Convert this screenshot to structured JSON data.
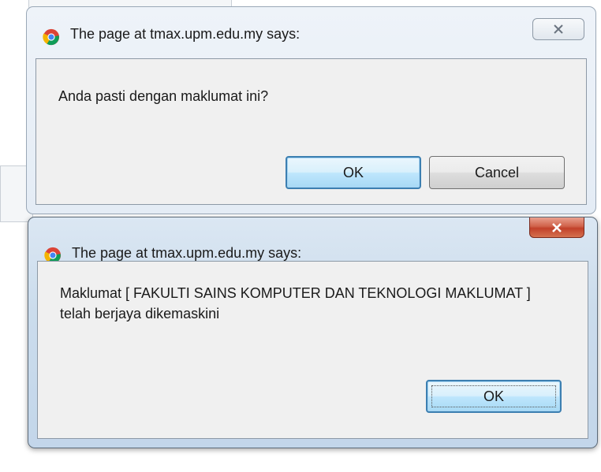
{
  "dialog_confirm": {
    "title": "The page at tmax.upm.edu.my says:",
    "message": "Anda pasti dengan maklumat ini?",
    "ok_label": "OK",
    "cancel_label": "Cancel",
    "close_icon": "close-icon"
  },
  "dialog_info": {
    "title": "The page at tmax.upm.edu.my says:",
    "message": "Maklumat [ FAKULTI SAINS KOMPUTER DAN TEKNOLOGI MAKLUMAT ] telah berjaya dikemaskini",
    "ok_label": "OK",
    "close_icon": "close-icon"
  },
  "colors": {
    "close_active": "#c2412a",
    "default_button_border": "#3c7fb1"
  }
}
